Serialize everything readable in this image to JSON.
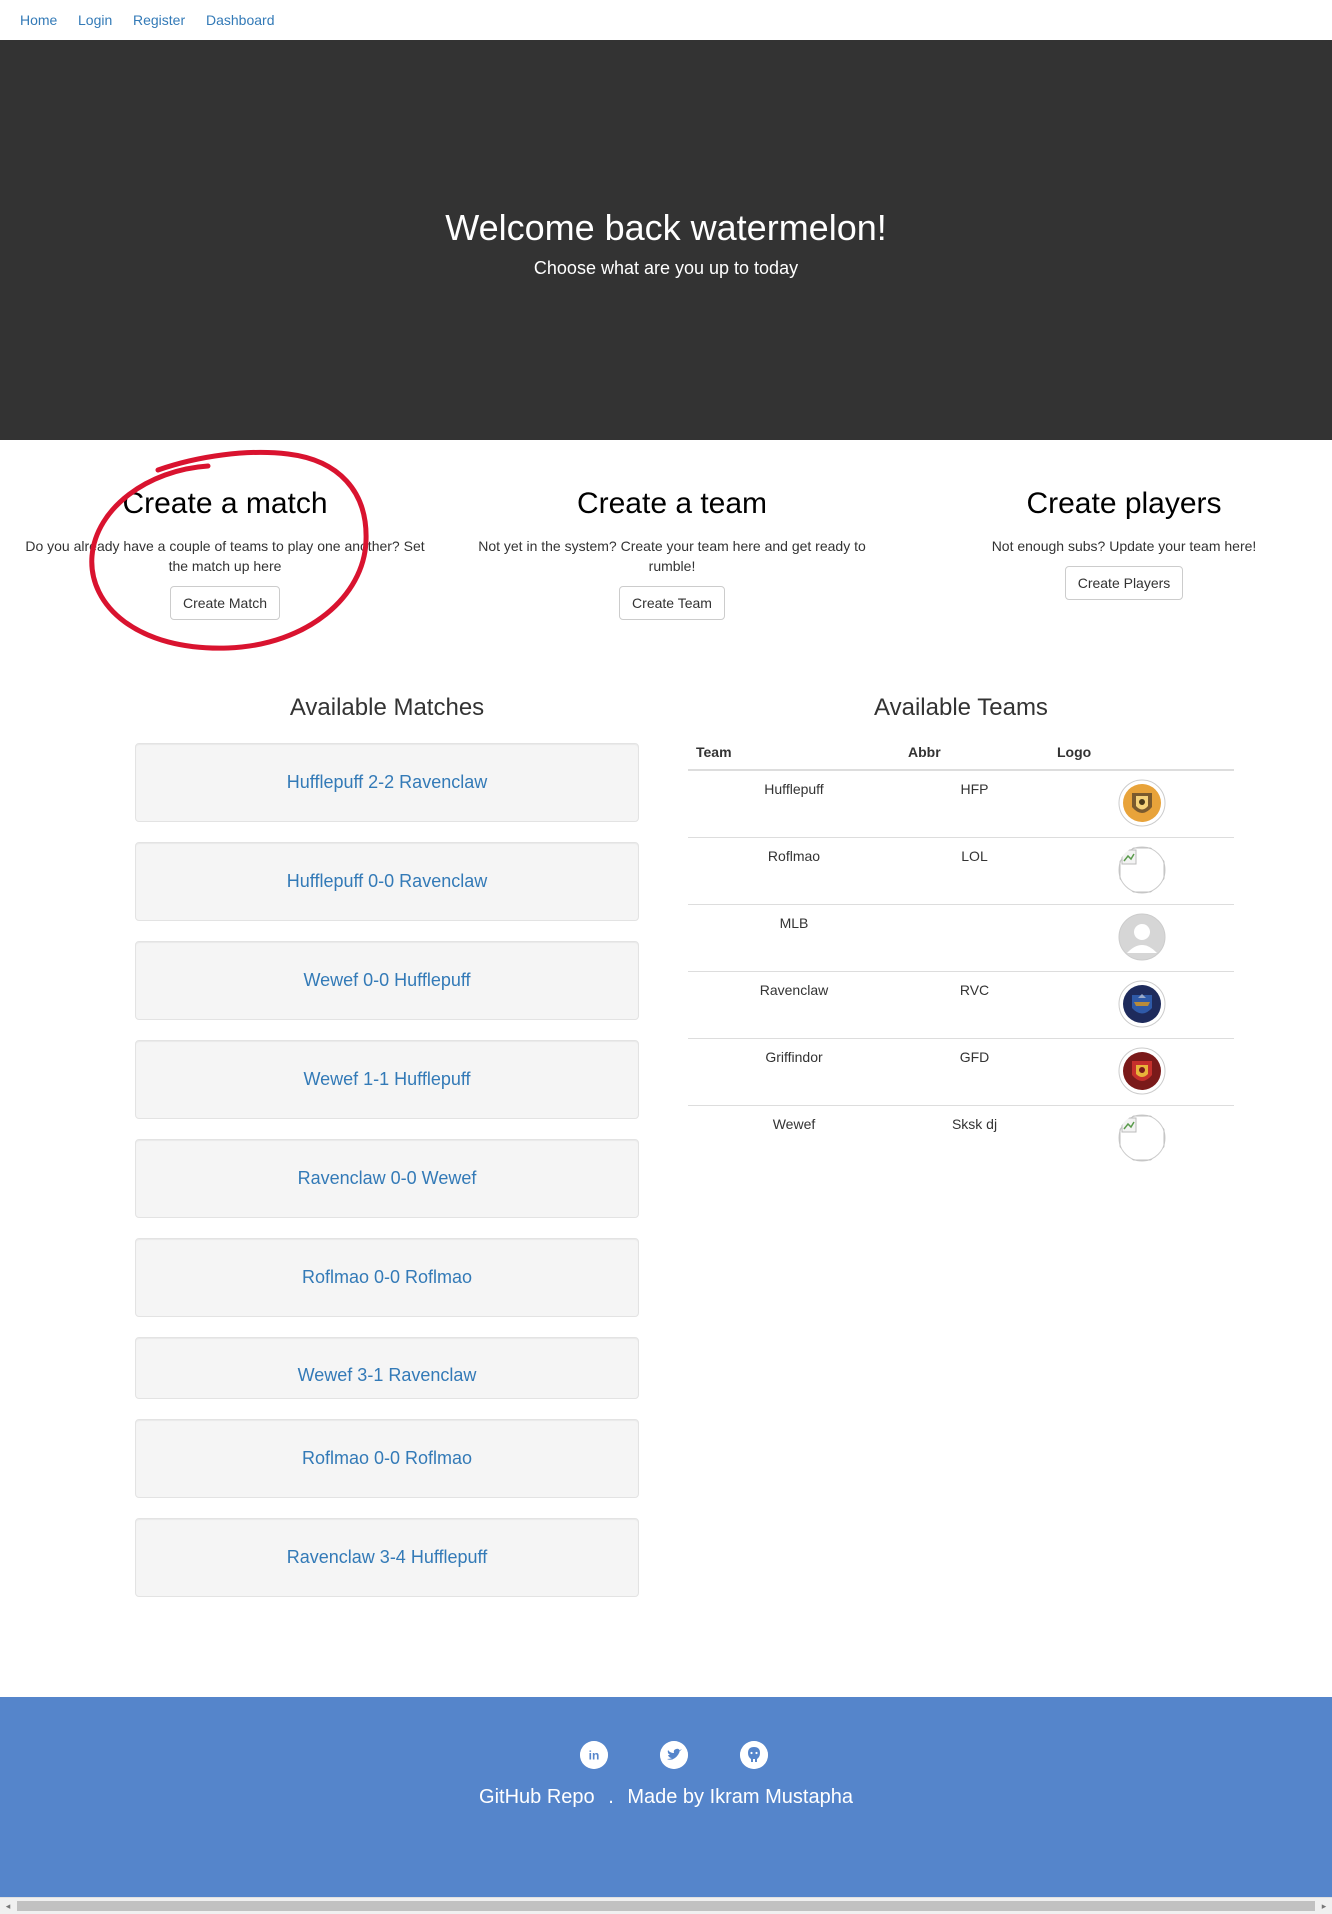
{
  "nav": {
    "items": [
      {
        "label": "Home"
      },
      {
        "label": "Login"
      },
      {
        "label": "Register"
      },
      {
        "label": "Dashboard"
      }
    ]
  },
  "hero": {
    "title": "Welcome back watermelon!",
    "subtitle": "Choose what are you up to today"
  },
  "actions": [
    {
      "title": "Create a match",
      "text": "Do you already have a couple of teams to play one another? Set the match up here",
      "button": "Create Match"
    },
    {
      "title": "Create a team",
      "text": "Not yet in the system? Create your team here and get ready to rumble!",
      "button": "Create Team"
    },
    {
      "title": "Create players",
      "text": "Not enough subs? Update your team here!",
      "button": "Create Players"
    }
  ],
  "matches": {
    "title": "Available Matches",
    "items": [
      "Hufflepuff 2-2 Ravenclaw",
      "Hufflepuff 0-0 Ravenclaw",
      "Wewef 0-0 Hufflepuff",
      "Wewef 1-1 Hufflepuff",
      "Ravenclaw 0-0 Wewef",
      "Roflmao 0-0 Roflmao",
      "Wewef 3-1 Ravenclaw",
      "Roflmao 0-0 Roflmao",
      "Ravenclaw 3-4 Hufflepuff"
    ]
  },
  "teams": {
    "title": "Available Teams",
    "columns": [
      "Team",
      "Abbr",
      "Logo"
    ],
    "rows": [
      {
        "team": "Hufflepuff",
        "abbr": "HFP",
        "logo": "hufflepuff-crest-icon"
      },
      {
        "team": "Roflmao",
        "abbr": "LOL",
        "logo": "broken-image-icon"
      },
      {
        "team": "MLB",
        "abbr": "",
        "logo": "default-avatar-icon"
      },
      {
        "team": "Ravenclaw",
        "abbr": "RVC",
        "logo": "ravenclaw-crest-icon"
      },
      {
        "team": "Griffindor",
        "abbr": "GFD",
        "logo": "gryffindor-crest-icon"
      },
      {
        "team": "Wewef",
        "abbr": "Sksk dj",
        "logo": "broken-image-icon"
      }
    ]
  },
  "footer": {
    "social": [
      "linkedin-icon",
      "twitter-icon",
      "github-icon"
    ],
    "repo_link": "GitHub Repo",
    "separator": ".",
    "credit": "Made by Ikram Mustapha",
    "bg_color": "#5585cb"
  },
  "colors": {
    "link": "#337ab7",
    "hero_bg": "#333333",
    "annotation_circle": "#d9132f"
  }
}
